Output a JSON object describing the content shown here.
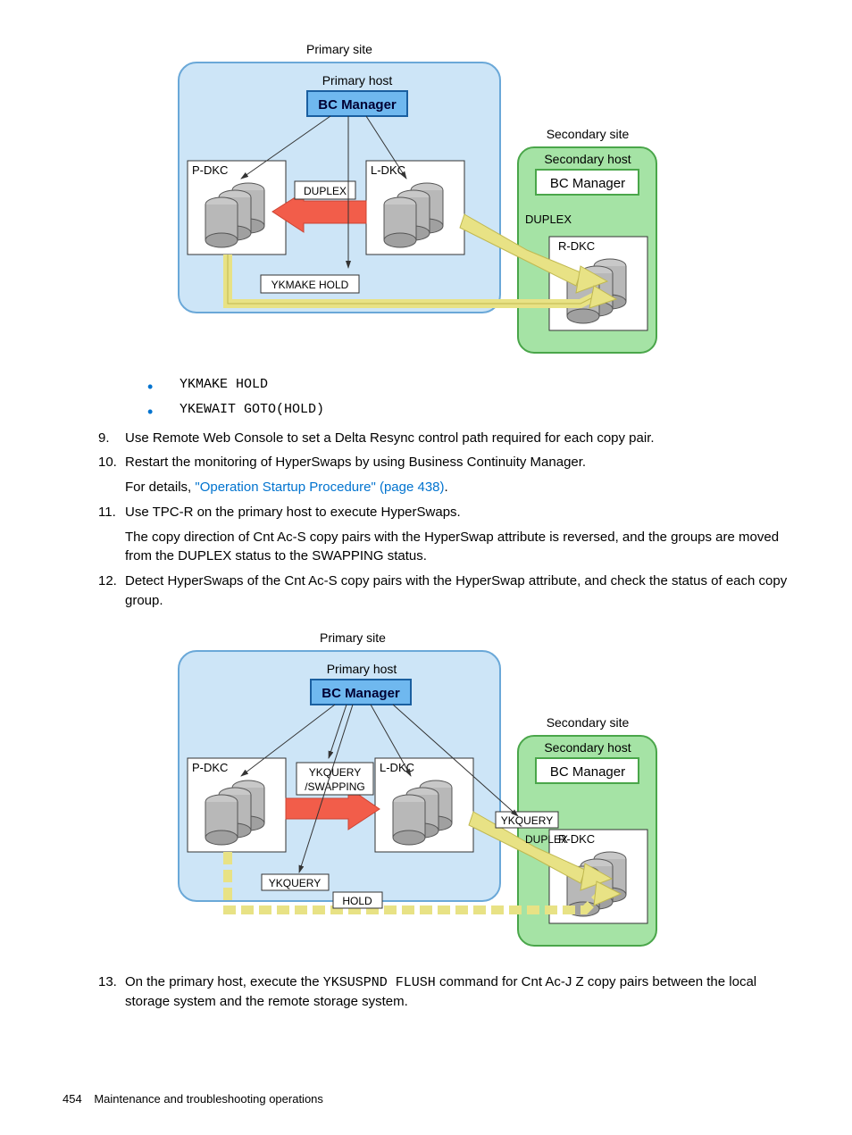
{
  "diagram1": {
    "primary_site": "Primary site",
    "primary_host": "Primary host",
    "secondary_site": "Secondary site",
    "secondary_host": "Secondary host",
    "bc_manager": "BC Manager",
    "pdkc": "P-DKC",
    "ldkc": "L-DKC",
    "rdkc": "R-DKC",
    "duplex": "DUPLEX",
    "ykmake_hold": "YKMAKE HOLD"
  },
  "bullets": {
    "b1": "YKMAKE HOLD",
    "b2": "YKEWAIT GOTO(HOLD)"
  },
  "steps": {
    "s9": {
      "num": "9.",
      "text": "Use Remote Web Console to set a Delta Resync control path required for each copy pair."
    },
    "s10": {
      "num": "10.",
      "text1": "Restart the monitoring of HyperSwaps by using Business Continuity Manager.",
      "text2a": "For details, ",
      "link": "\"Operation Startup Procedure\" (page 438)",
      "text2b": "."
    },
    "s11": {
      "num": "11.",
      "text1": "Use TPC-R on the primary host to execute HyperSwaps.",
      "text2": "The copy direction of Cnt Ac-S copy pairs with the HyperSwap attribute is reversed, and the groups are moved from the DUPLEX status to the SWAPPING status."
    },
    "s12": {
      "num": "12.",
      "text": "Detect HyperSwaps of the Cnt Ac-S copy pairs with the HyperSwap attribute, and check the status of each copy group."
    },
    "s13": {
      "num": "13.",
      "text1a": "On the primary host, execute the ",
      "code": "YKSUSPND FLUSH",
      "text1b": " command for Cnt Ac-J Z copy pairs between the local storage system and the remote storage system."
    }
  },
  "diagram2": {
    "primary_site": "Primary site",
    "primary_host": "Primary host",
    "secondary_site": "Secondary site",
    "secondary_host": "Secondary host",
    "bc_manager": "BC Manager",
    "pdkc": "P-DKC",
    "ldkc": "L-DKC",
    "rdkc": "R-DKC",
    "ykquery": "YKQUERY",
    "swapping": "/SWAPPING",
    "duplex": "DUPLEX",
    "hold": "HOLD"
  },
  "footer": {
    "page": "454",
    "title": "Maintenance and troubleshooting operations"
  }
}
